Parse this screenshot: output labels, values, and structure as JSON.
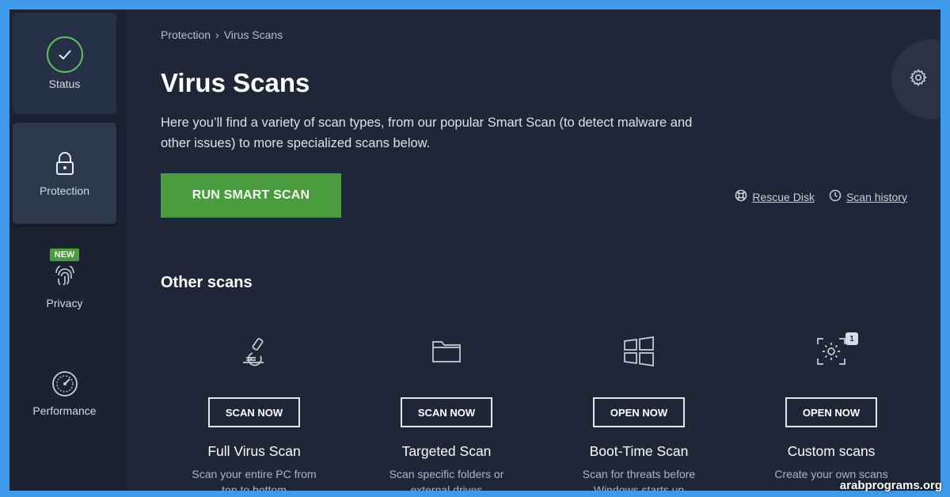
{
  "sidebar": {
    "items": [
      {
        "label": "Status",
        "icon": "check-circle-icon"
      },
      {
        "label": "Protection",
        "icon": "lock-icon"
      },
      {
        "label": "Privacy",
        "icon": "fingerprint-icon",
        "badge": "NEW"
      },
      {
        "label": "Performance",
        "icon": "speedometer-icon"
      }
    ]
  },
  "breadcrumb": {
    "parent": "Protection",
    "separator": "›",
    "current": "Virus Scans"
  },
  "page": {
    "title": "Virus Scans",
    "description": "Here you’ll find a variety of scan types, from our popular Smart Scan (to detect malware and other issues) to more specialized scans below."
  },
  "actions": {
    "run_smart_scan": "RUN SMART SCAN",
    "rescue_disk": "Rescue Disk",
    "scan_history": "Scan history"
  },
  "other_scans": {
    "title": "Other scans",
    "cards": [
      {
        "name": "Full Virus Scan",
        "button": "SCAN NOW",
        "desc_line1": "Scan your entire PC from",
        "desc_line2": "top to bottom",
        "icon": "microscope-icon"
      },
      {
        "name": "Targeted Scan",
        "button": "SCAN NOW",
        "desc_line1": "Scan specific folders or",
        "desc_line2": "external drives",
        "icon": "folder-icon"
      },
      {
        "name": "Boot-Time Scan",
        "button": "OPEN NOW",
        "desc_line1": "Scan for threats before",
        "desc_line2": "Windows starts up",
        "icon": "windows-icon"
      },
      {
        "name": "Custom scans",
        "button": "OPEN NOW",
        "desc_line1": "Create your own scans",
        "desc_line2": "",
        "icon": "custom-scan-icon",
        "count": "1"
      }
    ]
  },
  "watermark": "arabprograms.org",
  "colors": {
    "background": "#1e2637",
    "accent_green": "#4a9c3e",
    "frame_blue": "#3d9bea"
  }
}
